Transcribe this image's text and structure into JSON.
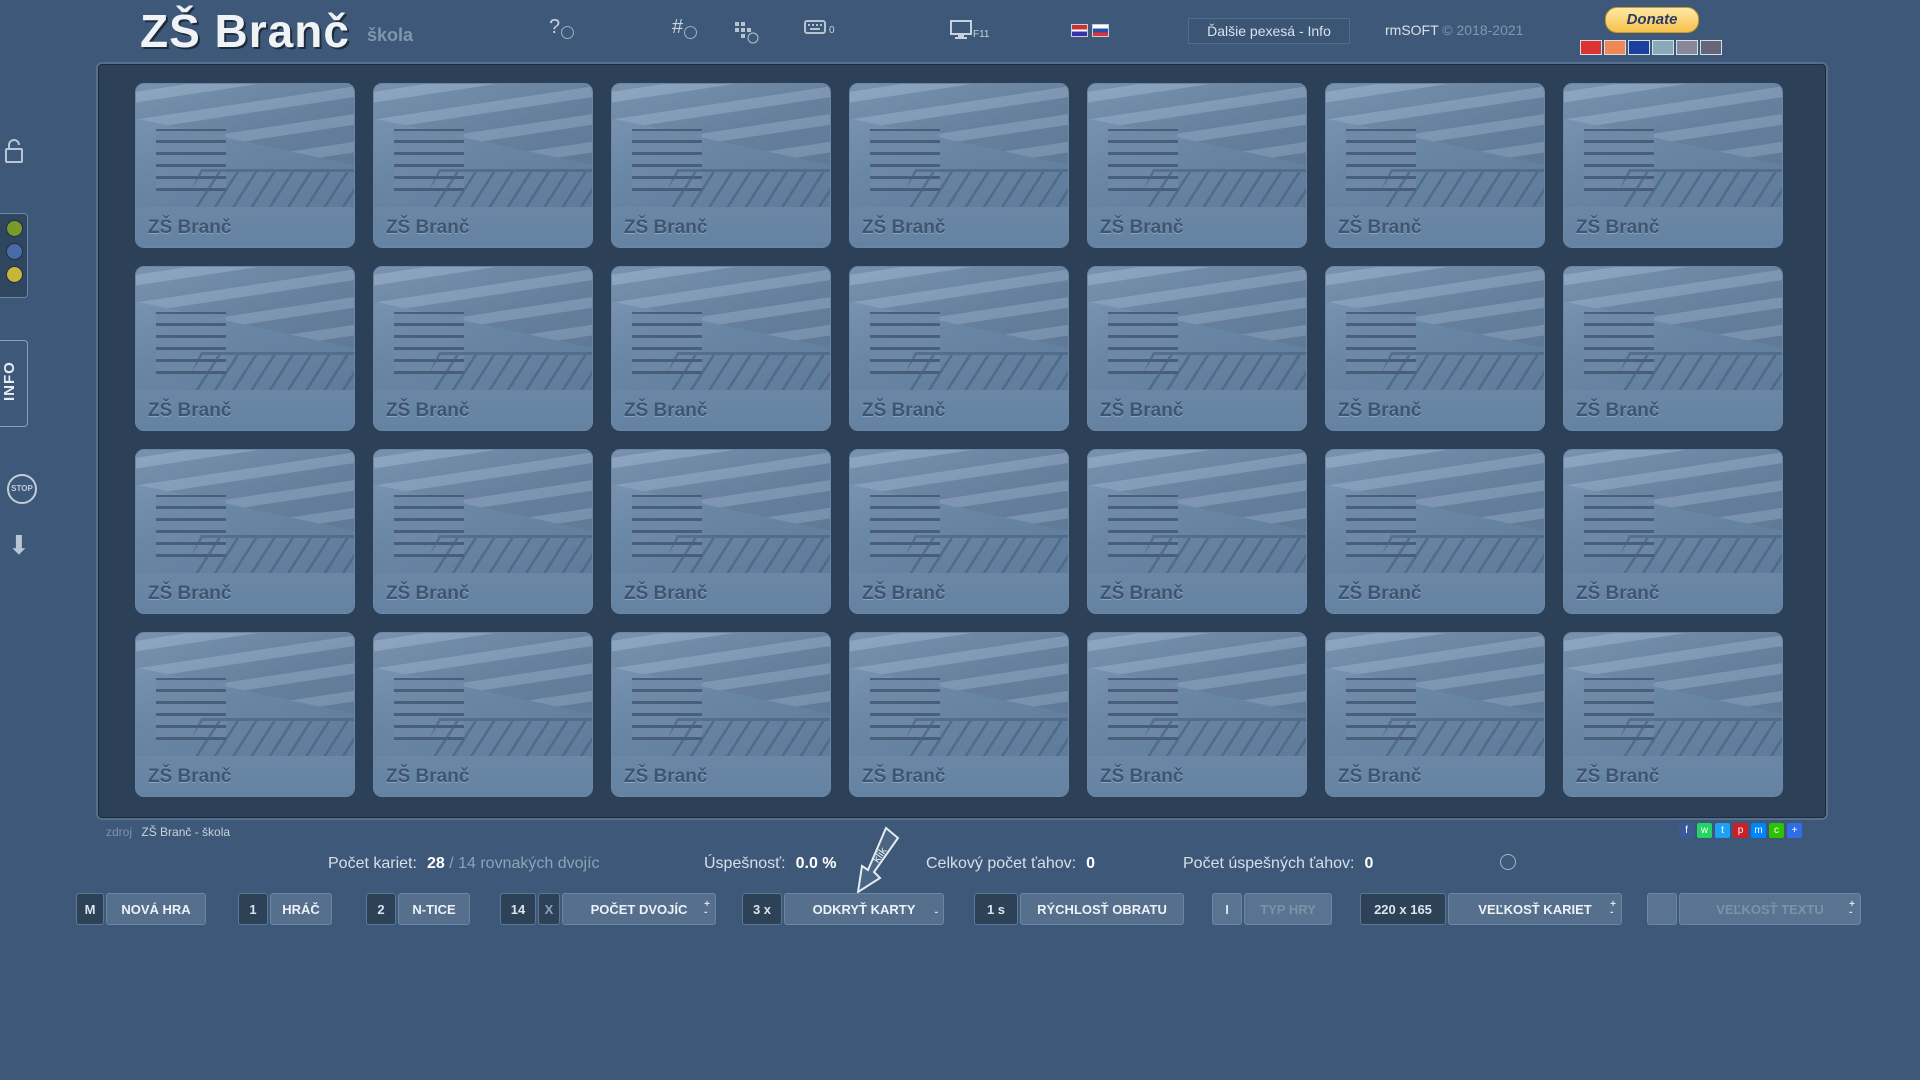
{
  "header": {
    "title": "ZŠ Branč",
    "subtitle": "škola",
    "icons": [
      "help-icon",
      "hash-icon",
      "grid-icon",
      "keyboard-icon",
      "monitor-icon"
    ],
    "help_label": "?",
    "hash_label": "#",
    "keyboard_count": "0",
    "fullscreen_key": "F11",
    "more_games": "Ďalšie pexesá - Info",
    "brand": "rmSOFT",
    "copyright": "© 2018-2021",
    "donate": "Donate"
  },
  "sidebar": {
    "info_label": "INFO",
    "stop_label": "STOP",
    "color_dots": [
      "#7a9a2a",
      "#4a6ba8",
      "#c7b63a"
    ]
  },
  "board": {
    "card_label": "ZŠ Branč",
    "rows": 4,
    "cols": 7
  },
  "footer": {
    "source_label": "zdroj",
    "source_value": "ZŠ Branč - škola",
    "social_icons": [
      "facebook-icon",
      "whatsapp-icon",
      "twitter-icon",
      "pinterest-icon",
      "messenger-icon",
      "wechat-icon",
      "share-icon"
    ],
    "stats": {
      "cards_label": "Počet kariet:",
      "cards_value": "28",
      "pairs_sep": "/",
      "pairs_value": "14",
      "pairs_label": "rovnakých dvojíc",
      "success_label": "Úspešnosť:",
      "success_value": "0.0 %",
      "moves_label": "Celkový počet ťahov:",
      "moves_value": "0",
      "good_moves_label": "Počet úspešných ťahov:",
      "good_moves_value": "0"
    },
    "klik": "klik"
  },
  "controls": {
    "new_game": {
      "key": "M",
      "label": "NOVÁ HRA"
    },
    "player": {
      "key": "1",
      "label": "HRÁČ"
    },
    "ntice": {
      "key": "2",
      "label": "N-TICE"
    },
    "pairs": {
      "key": "14",
      "x": "X",
      "label": "POČET DVOJÍC"
    },
    "reveal": {
      "key": "3 x",
      "label": "ODKRYŤ KARTY"
    },
    "speed": {
      "key": "1 s",
      "label": "RÝCHLOSŤ OBRATU"
    },
    "game_type": {
      "key": "I",
      "label": "TYP HRY"
    },
    "card_size": {
      "key": "220 x 165",
      "label": "VEĽKOSŤ KARIET"
    },
    "text_size": {
      "key": "",
      "label": "VEĽKOSŤ TEXTU"
    }
  }
}
